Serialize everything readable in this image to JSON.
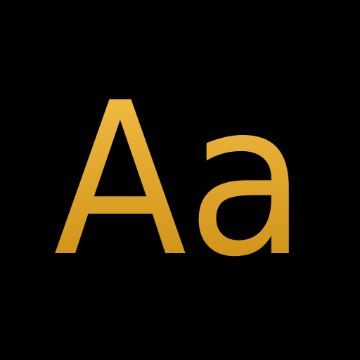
{
  "icon": {
    "name": "font-icon",
    "text": "Aa",
    "background_color": "#000000",
    "gradient_top": "#f7c24a",
    "gradient_bottom": "#c98a0e"
  }
}
